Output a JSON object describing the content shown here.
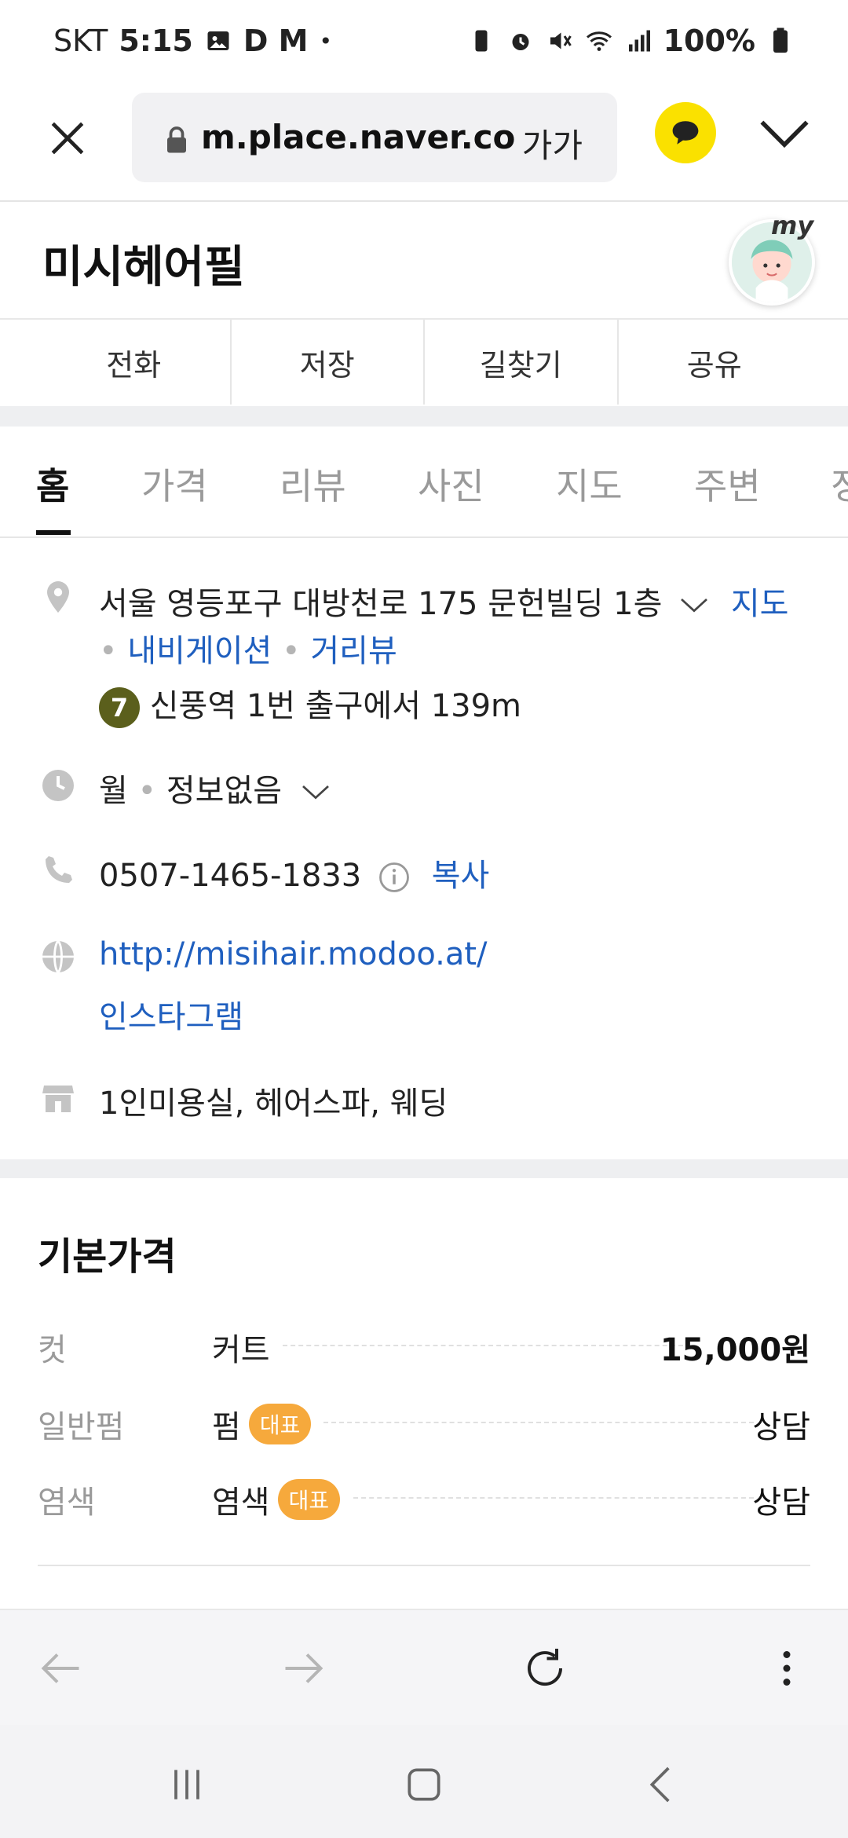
{
  "status_bar": {
    "carrier": "SKT",
    "time": "5:15",
    "app_letters": "D M",
    "battery": "100%"
  },
  "browser": {
    "url": "m.place.naver.com",
    "font_size_label": "가가"
  },
  "place": {
    "name": "미시헤어필",
    "my_label": "my"
  },
  "actions": [
    "전화",
    "저장",
    "길찾기",
    "공유"
  ],
  "tabs": [
    "홈",
    "가격",
    "리뷰",
    "사진",
    "지도",
    "주변",
    "정"
  ],
  "info": {
    "address": "서울 영등포구 대방천로 175 문헌빌딩 1층",
    "map_link": "지도",
    "navigation_link": "내비게이션",
    "streetview_link": "거리뷰",
    "subway_line": "7",
    "subway_directions": "신풍역 1번 출구에서 139m",
    "hours_day": "월",
    "hours_status": "정보없음",
    "phone": "0507-1465-1833",
    "copy_label": "복사",
    "website": "http://misihair.modoo.at/",
    "instagram": "인스타그램",
    "category": "1인미용실, 헤어스파, 웨딩"
  },
  "price_section": {
    "title": "기본가격",
    "rows": [
      {
        "category": "컷",
        "name": "커트",
        "badge": "",
        "price": "15,000원"
      },
      {
        "category": "일반펌",
        "name": "펌",
        "badge": "대표",
        "price": "상담"
      },
      {
        "category": "염색",
        "name": "염색",
        "badge": "대표",
        "price": "상담"
      }
    ]
  },
  "colors": {
    "link": "#1f5fbf",
    "kakao_yellow": "#fae100",
    "badge": "#f6a93c",
    "subway_line7": "#5b5f1c"
  },
  "icons": {
    "close": "close-icon",
    "lock": "lock-icon",
    "talk": "chat-bubble-icon",
    "location": "location-pin-icon",
    "clock": "clock-icon",
    "phone": "phone-icon",
    "globe": "globe-icon",
    "store": "store-icon"
  }
}
